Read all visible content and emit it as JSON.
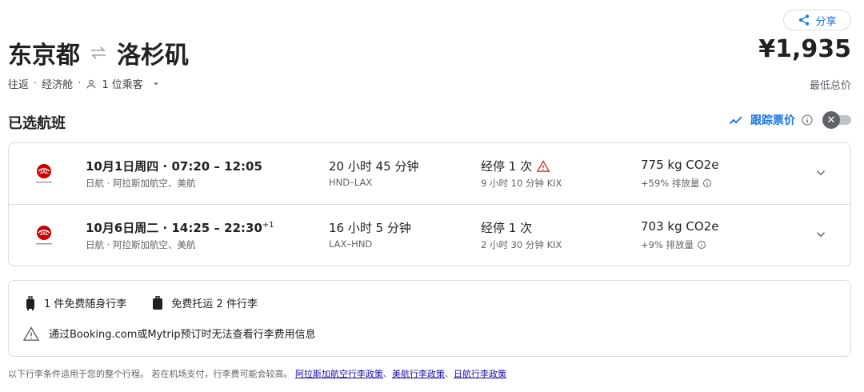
{
  "header": {
    "share_label": "分享",
    "origin": "东京都",
    "destination": "洛杉矶",
    "price": "¥1,935",
    "price_note": "最低总价",
    "trip_type": "往返",
    "cabin": "经济舱",
    "passengers": "1 位乘客"
  },
  "section": {
    "title": "已选航班",
    "track_label": "跟踪票价"
  },
  "flights": [
    {
      "datetime": "10月1日周四 · 07:20 – 12:05",
      "day_offset": "",
      "airlines": "日航 · 阿拉斯加航空、美航",
      "duration": "20 小时 45 分钟",
      "route": "HND–LAX",
      "stops": "经停 1 次",
      "layover": "9 小时 10 分钟 KIX",
      "co2": "775 kg CO2e",
      "co2_note": "+59% 排放量",
      "warning": true
    },
    {
      "datetime": "10月6日周二 · 14:25 – 22:30",
      "day_offset": "+1",
      "airlines": "日航 · 阿拉斯加航空、美航",
      "duration": "16 小时 5 分钟",
      "route": "LAX–HND",
      "stops": "经停 1 次",
      "layover": "2 小时 30 分钟 KIX",
      "co2": "703 kg CO2e",
      "co2_note": "+9% 排放量",
      "warning": false
    }
  ],
  "baggage": {
    "carry_on": "1 件免费随身行李",
    "checked": "免费托运 2 件行李",
    "warning_text": "通过Booking.com或Mytrip预订时无法查看行李费用信息"
  },
  "footer": {
    "text": "以下行李条件适用于您的整个行程。 若在机场支付，行李费可能会较高。",
    "link1": "阿拉斯加航空行李政策",
    "sep1": "、",
    "link2": "美航行李政策",
    "sep2": "、",
    "link3": "日航行李政策"
  },
  "colors": {
    "accent": "#1a73e8",
    "warning": "#d93025",
    "jal_red": "#cc0000"
  }
}
